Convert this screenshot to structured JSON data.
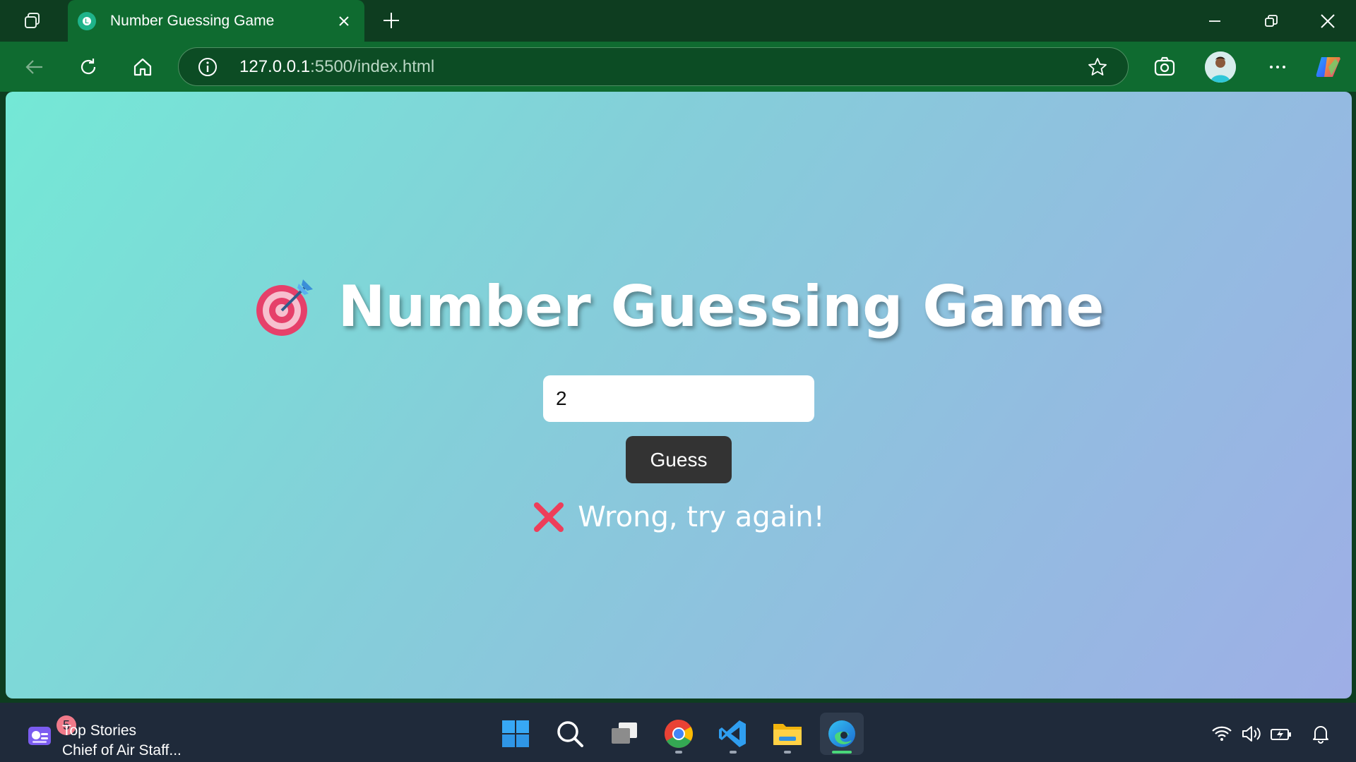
{
  "browser": {
    "tab_title": "Number Guessing Game",
    "tab_favicon_letter": "L",
    "url_host": "127.0.0.1",
    "url_rest": ":5500/index.html",
    "icons": [
      "workspaces-icon",
      "close-tab-icon",
      "new-tab-icon",
      "minimize-icon",
      "restore-icon",
      "close-window-icon",
      "back-icon",
      "refresh-icon",
      "home-icon",
      "site-info-icon",
      "favorite-star-icon",
      "screenshot-icon",
      "profile-avatar",
      "more-options-icon",
      "copilot-icon"
    ]
  },
  "game": {
    "title": "Number Guessing Game",
    "title_icon": "dart-target-icon",
    "input_value": "2",
    "button_label": "Guess",
    "result_text": "Wrong, try again!",
    "result_icon": "cross-mark-icon"
  },
  "taskbar": {
    "news_badge": "5",
    "news_title": "Top Stories",
    "news_subtitle": "Chief of Air Staff...",
    "apps": [
      "start-icon",
      "search-icon",
      "task-view-icon",
      "chrome-icon",
      "vscode-icon",
      "file-explorer-icon",
      "edge-icon"
    ],
    "tray": [
      "wifi-icon",
      "volume-icon",
      "battery-icon",
      "notification-bell-icon"
    ]
  },
  "colors": {
    "titlebar": "#0e3d20",
    "toolbar": "#0f6b30",
    "page_gradient_start": "#74e8d6",
    "page_gradient_end": "#9eaee6",
    "button_bg": "#333333",
    "taskbar": "#1f2a3a"
  }
}
